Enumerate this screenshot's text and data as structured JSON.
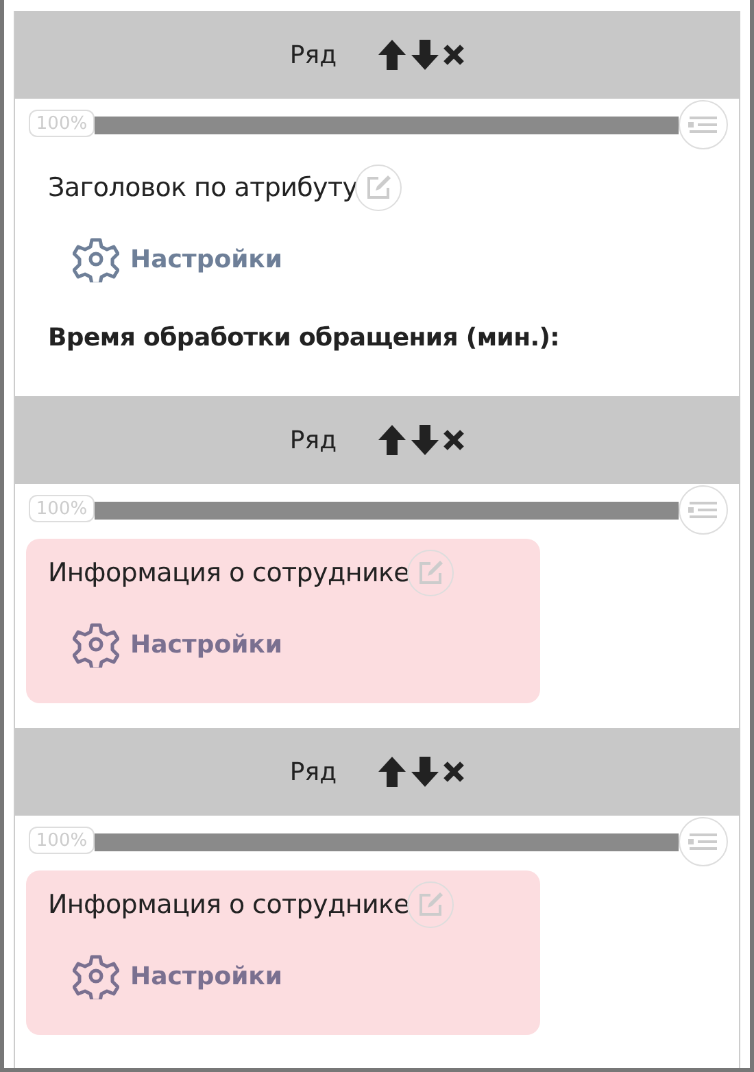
{
  "rows": [
    {
      "header": "Ряд",
      "zoom": {
        "label": "100%",
        "level": 1
      },
      "widget": {
        "title": "Заголовок по атрибуту",
        "highlighted": false,
        "settings": "Настройки"
      },
      "field_label": "Время обработки обращения (мин.):"
    },
    {
      "header": "Ряд",
      "zoom": {
        "label": "100%",
        "level": 1
      },
      "widget": {
        "title": "Информация о сотруднике",
        "highlighted": true,
        "settings": "Настройки"
      }
    },
    {
      "header": "Ряд",
      "zoom": {
        "label": "100%",
        "level": 1
      },
      "widget": {
        "title": "Информация о сотруднике",
        "highlighted": true,
        "settings": "Настройки"
      }
    }
  ]
}
